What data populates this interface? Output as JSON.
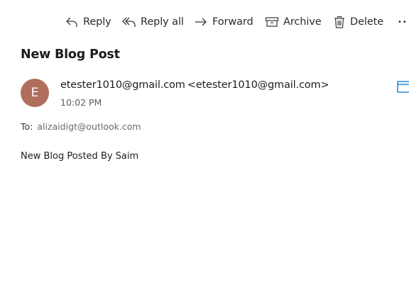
{
  "toolbar": {
    "reply_label": "Reply",
    "reply_all_label": "Reply all",
    "forward_label": "Forward",
    "archive_label": "Archive",
    "delete_label": "Delete",
    "more_label": "••"
  },
  "icons": {
    "reply": "reply-icon",
    "reply_all": "reply-all-icon",
    "forward": "forward-icon",
    "archive": "archive-icon",
    "delete": "trash-icon",
    "popout": "popout-icon"
  },
  "message": {
    "subject": "New Blog Post",
    "avatar_initial": "E",
    "avatar_color": "#b06f5c",
    "sender_name": "etester1010@gmail.com",
    "sender_address": "<etester1010@gmail.com>",
    "time": "10:02 PM",
    "to_label": "To:",
    "to_address": "alizaidigt@outlook.com",
    "body": "New Blog Posted By Saim"
  },
  "colors": {
    "accent": "#0078d4",
    "text": "#1c1c1c",
    "muted": "#5e5e5e"
  }
}
